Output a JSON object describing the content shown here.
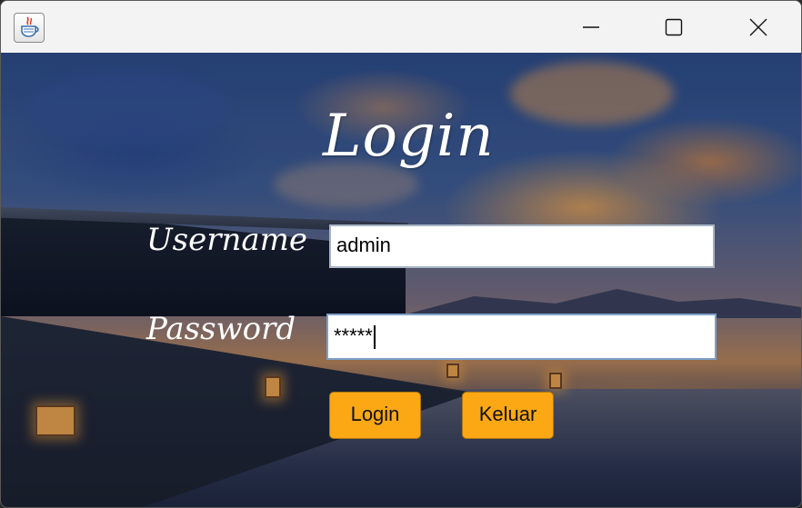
{
  "window": {
    "app_icon": "java-cup-icon",
    "controls": [
      "minimize-icon",
      "maximize-icon",
      "close-icon"
    ]
  },
  "form": {
    "title": "Login",
    "username_label": "Username",
    "username_value": "admin",
    "password_label": "Password",
    "password_value": "*****",
    "login_button": "Login",
    "exit_button": "Keluar"
  },
  "colors": {
    "button_bg": "#fca814",
    "title_text": "#ffffff"
  }
}
